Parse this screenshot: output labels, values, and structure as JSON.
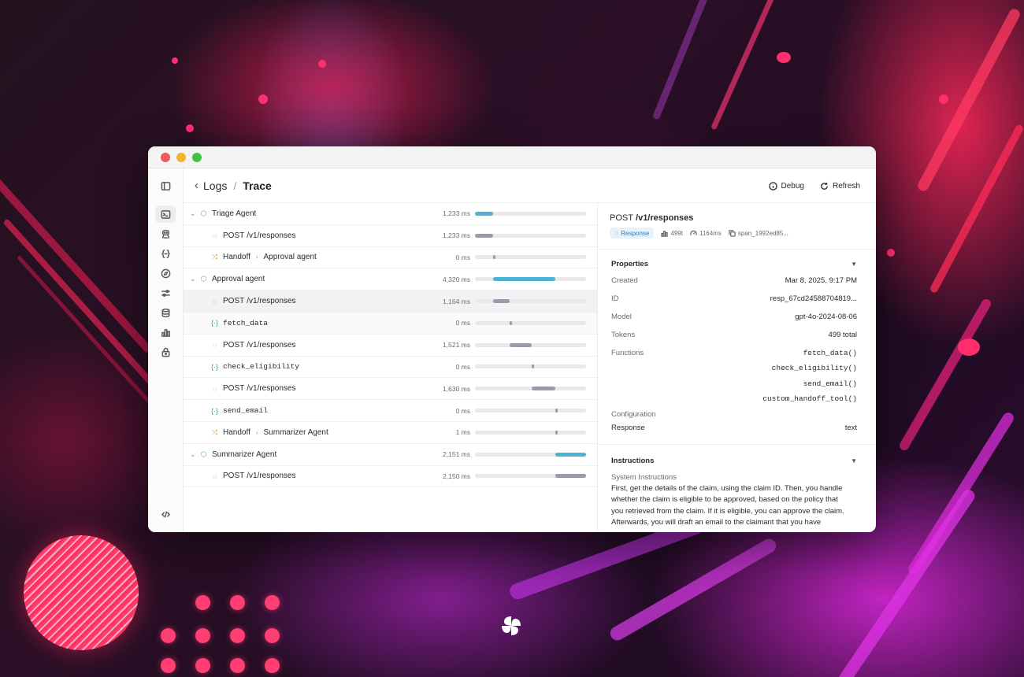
{
  "window": {
    "breadcrumb": {
      "parent": "Logs",
      "separator": "/",
      "current": "Trace"
    },
    "actions": {
      "debug": "Debug",
      "refresh": "Refresh"
    }
  },
  "rail_icons": [
    "sidebar-toggle-icon",
    "terminal-icon",
    "agent-icon",
    "braces-icon",
    "compass-icon",
    "sliders-icon",
    "database-icon",
    "bar-chart-icon",
    "lock-icon",
    "code-icon"
  ],
  "trace": [
    {
      "kind": "agent",
      "label": "Triage Agent",
      "duration": "1,233 ms",
      "bar": {
        "start": 0,
        "width": 0.16,
        "color": "#4bb3d3"
      }
    },
    {
      "kind": "request",
      "method": "POST",
      "path": "/v1/responses",
      "duration": "1,233 ms",
      "bar": {
        "start": 0,
        "width": 0.16,
        "color": "#9b9aa8"
      }
    },
    {
      "kind": "handoff",
      "from": "Handoff",
      "to": "Approval agent",
      "duration": "0 ms",
      "bar": {
        "start": 0.16,
        "width": 0.015,
        "color": "#9b9aa8"
      }
    },
    {
      "kind": "agent",
      "label": "Approval agent",
      "duration": "4,320 ms",
      "bar": {
        "start": 0.16,
        "width": 0.56,
        "color": "#4bb3d3"
      }
    },
    {
      "kind": "request",
      "method": "POST",
      "path": "/v1/responses",
      "duration": "1,164 ms",
      "bar": {
        "start": 0.16,
        "width": 0.15,
        "color": "#9b9aa8"
      },
      "selected": true
    },
    {
      "kind": "function",
      "label": "fetch_data",
      "duration": "0 ms",
      "bar": {
        "start": 0.31,
        "width": 0.015,
        "color": "#9b9aa8"
      },
      "hover": true
    },
    {
      "kind": "request",
      "method": "POST",
      "path": "/v1/responses",
      "duration": "1,521 ms",
      "bar": {
        "start": 0.31,
        "width": 0.2,
        "color": "#9b9aa8"
      }
    },
    {
      "kind": "function",
      "label": "check_eligibility",
      "duration": "0 ms",
      "bar": {
        "start": 0.51,
        "width": 0.015,
        "color": "#9b9aa8"
      }
    },
    {
      "kind": "request",
      "method": "POST",
      "path": "/v1/responses",
      "duration": "1,630 ms",
      "bar": {
        "start": 0.51,
        "width": 0.21,
        "color": "#9b9aa8"
      }
    },
    {
      "kind": "function",
      "label": "send_email",
      "duration": "0 ms",
      "bar": {
        "start": 0.72,
        "width": 0.015,
        "color": "#9b9aa8"
      }
    },
    {
      "kind": "handoff",
      "from": "Handoff",
      "to": "Summarizer Agent",
      "duration": "1 ms",
      "bar": {
        "start": 0.72,
        "width": 0.015,
        "color": "#9b9aa8"
      }
    },
    {
      "kind": "agent",
      "label": "Summarizer Agent",
      "duration": "2,151 ms",
      "bar": {
        "start": 0.72,
        "width": 0.28,
        "color": "#4bb3d3"
      }
    },
    {
      "kind": "request",
      "method": "POST",
      "path": "/v1/responses",
      "duration": "2,150 ms",
      "bar": {
        "start": 0.72,
        "width": 0.28,
        "color": "#9b9aa8"
      }
    }
  ],
  "detail": {
    "method": "POST",
    "path": "/v1/responses",
    "badge": "Response",
    "tokens_short": "499t",
    "latency": "1164ms",
    "span": "span_1992ed85...",
    "properties": {
      "title": "Properties",
      "created_label": "Created",
      "created": "Mar 8, 2025, 9:17 PM",
      "id_label": "ID",
      "id": "resp_67cd24588704819...",
      "model_label": "Model",
      "model": "gpt-4o-2024-08-06",
      "tokens_label": "Tokens",
      "tokens": "499 total",
      "functions_label": "Functions",
      "functions": [
        "fetch_data()",
        "check_eligibility()",
        "send_email()",
        "custom_handoff_tool()"
      ],
      "configuration_label": "Configuration",
      "response_label": "Response",
      "response": "text"
    },
    "instructions": {
      "title": "Instructions",
      "system_label": "System Instructions",
      "lines": [
        "First, get the details of the claim, using the claim ID. Then, you handle",
        "whether the claim is eligible to be approved, based on the policy that",
        "you retrieved from the claim. If it is eligible, you can approve the claim.",
        "Afterwards, you will draft an email to the claimant that you have"
      ]
    }
  },
  "colors": {
    "agent_bar": "#4bb3d3",
    "span_bar": "#9b9aa8",
    "accent_blue": "#2a7fc1",
    "handoff_orange": "#e8902a",
    "function_green": "#3aa56b"
  }
}
